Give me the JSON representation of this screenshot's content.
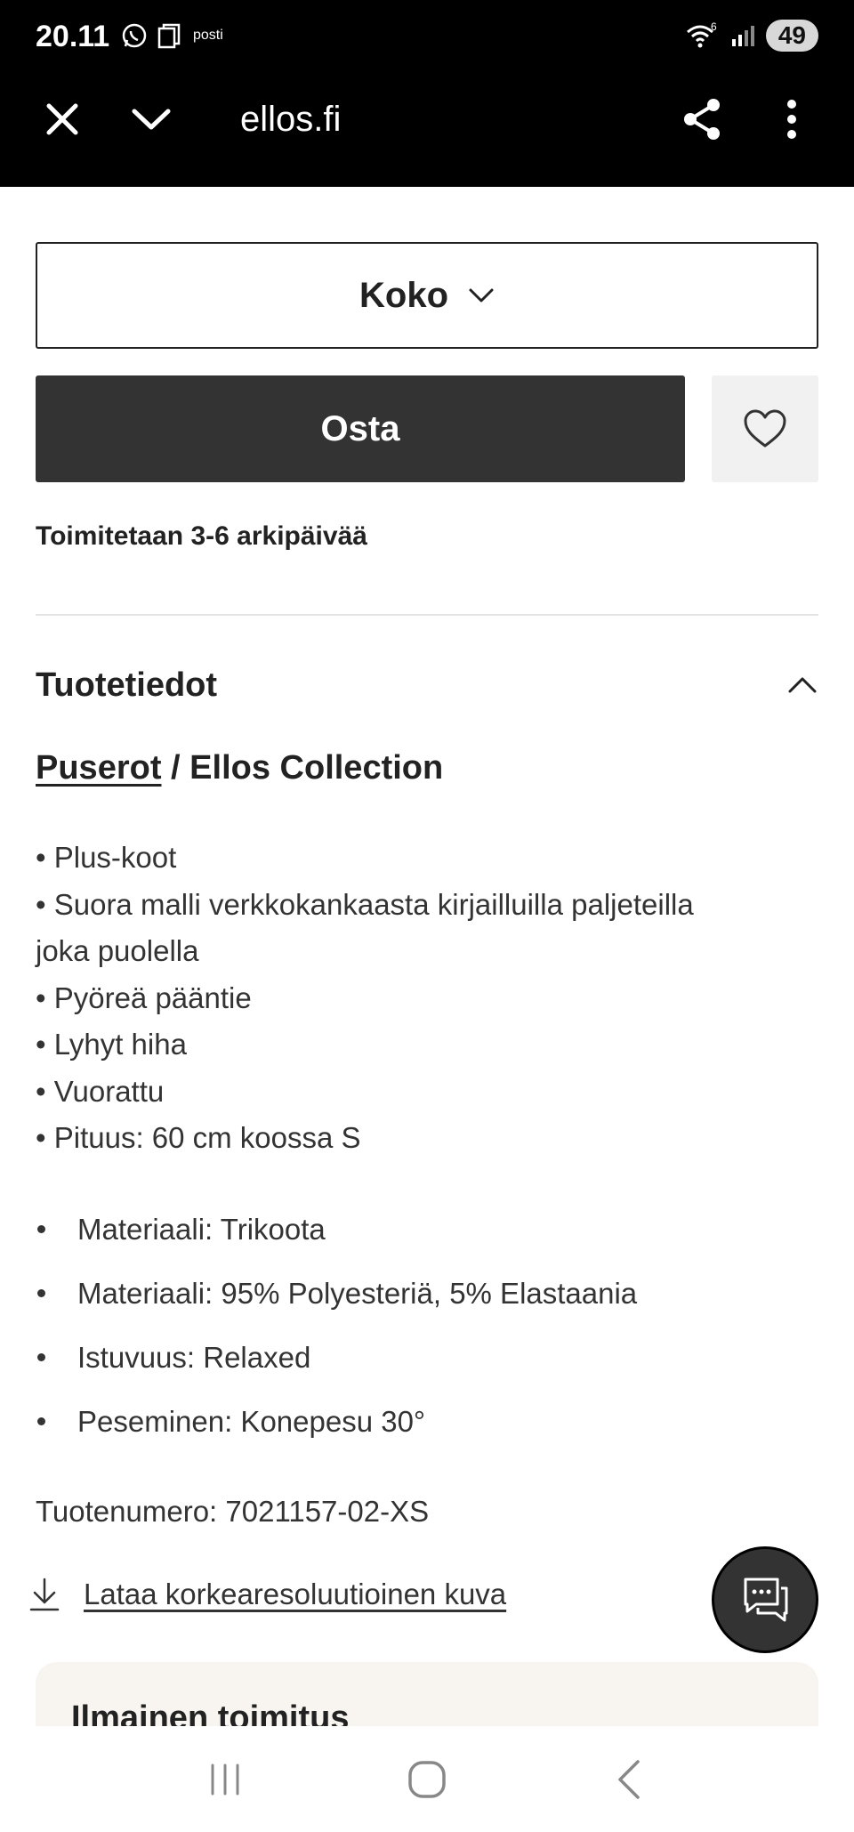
{
  "status_bar": {
    "time": "20.11",
    "carrier_tag": "posti",
    "battery": "49",
    "wifi_badge": "6"
  },
  "browser": {
    "url": "ellos.fi",
    "icons": [
      "close-icon",
      "chevron-down-icon",
      "share-icon",
      "more-vertical-icon"
    ]
  },
  "product": {
    "size_label": "Koko",
    "buy_label": "Osta",
    "delivery": "Toimitetaan 3-6 arkipäivää",
    "section_title": "Tuotetiedot",
    "breadcrumb": {
      "link": "Puserot",
      "separator": " / ",
      "brand": "Ellos Collection"
    },
    "bullets": [
      "• Plus-koot",
      "• Suora malli verkkokankaasta kirjailluilla paljeteilla",
      "joka puolella",
      "• Pyöreä pääntie",
      "• Lyhyt hiha",
      "• Vuorattu",
      "• Pituus: 60 cm koossa S"
    ],
    "specs": [
      "Materiaali: Trikoota",
      "Materiaali: 95% Polyesteriä, 5% Elastaania",
      "Istuvuus: Relaxed",
      "Peseminen: Konepesu 30°"
    ],
    "product_number": "Tuotenumero: 7021157-02-XS",
    "download_label": "Lataa korkearesoluutioinen kuva",
    "promo_title": "Ilmainen toimitus"
  },
  "colors": {
    "buy_button": "#333333",
    "wish_button": "#f1f1f1",
    "promo_bg": "#f8f5f1",
    "chat_button": "#333333"
  }
}
